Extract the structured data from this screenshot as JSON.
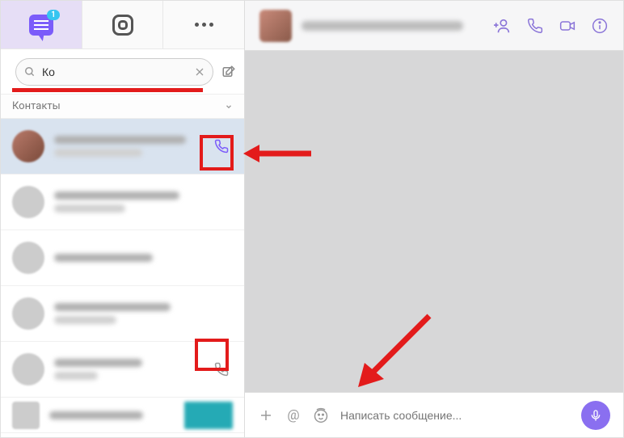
{
  "tabs": {
    "chat_badge": "1"
  },
  "search": {
    "value": "Ко",
    "placeholder": ""
  },
  "section": {
    "contacts_label": "Контакты"
  },
  "composer": {
    "placeholder": "Написать сообщение..."
  },
  "colors": {
    "accent": "#7b5cfa",
    "annotation": "#e31b1b"
  }
}
